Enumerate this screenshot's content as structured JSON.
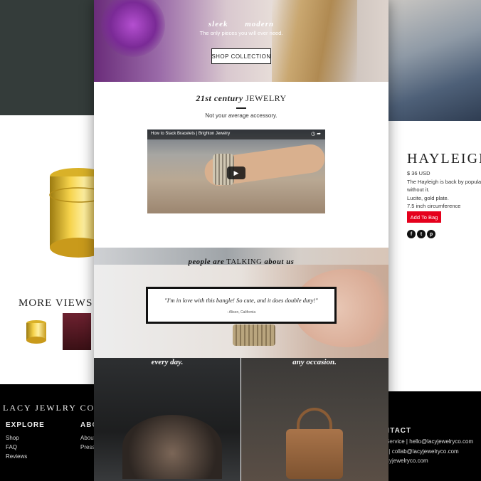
{
  "left_page": {
    "more_views": "MORE VIEWS",
    "footer": {
      "brand": "LACY JEWLRY CO.",
      "explore": {
        "heading": "EXPLORE",
        "links": [
          "Shop",
          "FAQ",
          "Reviews"
        ]
      },
      "about": {
        "heading": "ABO",
        "links": [
          "About",
          "Press"
        ]
      }
    }
  },
  "center_page": {
    "hero": {
      "tag_left": "sleek",
      "tag_right": "modern",
      "subtitle": "The only pieces you will ever need.",
      "shop_button": "SHOP COLLECTION"
    },
    "intro": {
      "title_italic": "21st century",
      "title_caps": "JEWELRY",
      "subtitle": "Not your average accessory."
    },
    "video": {
      "title": "How to Stack Bracelets | Brighton Jewelry",
      "icons": "◷ ➦"
    },
    "testimonials": {
      "heading_a": "people are",
      "heading_b": "TALKING",
      "heading_c": "about us",
      "quote": "\"I'm in love with this bangle! So cute, and it does double duty!\"",
      "author": "- Alison, California"
    },
    "bottom": {
      "caption_left": "every day.",
      "caption_right": "any occasion."
    }
  },
  "right_page": {
    "product": {
      "name": "HAYLEIGH",
      "price": "$ 36 USD",
      "description": "The Hayleigh is back by popular d",
      "description_2": "without it.",
      "material": "Lucite, gold plate.",
      "size": "7.5 inch circumference",
      "add_button": "Add To Bag"
    },
    "social": [
      "f",
      "t",
      "p"
    ],
    "footer": {
      "heading": "NTACT",
      "lines": [
        "mer Service | hello@lacyjewelryco.com",
        "orate | collab@lacyjewelryco.com",
        "r@lacyjewelryco.com"
      ]
    }
  },
  "colors": {
    "accent_red": "#e5001c",
    "footer_black": "#000000",
    "left_banner": "#343c3a"
  }
}
